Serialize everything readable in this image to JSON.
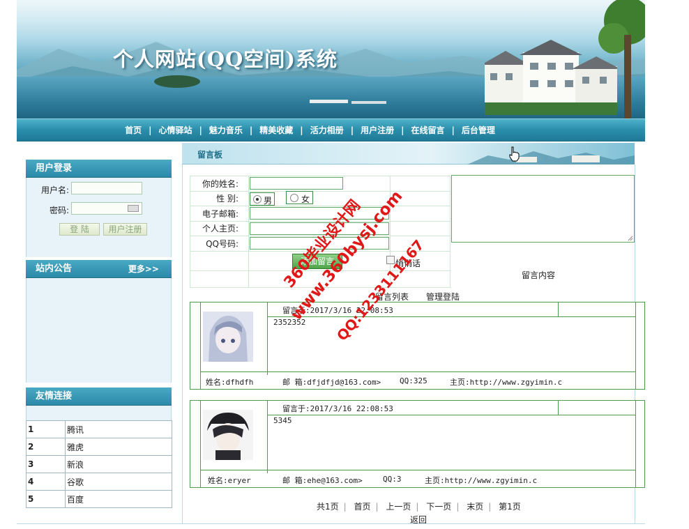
{
  "header": {
    "site_title": "个人网站(QQ空间)系统"
  },
  "nav": {
    "items": [
      {
        "label": "首页"
      },
      {
        "label": "心情驿站"
      },
      {
        "label": "魅力音乐"
      },
      {
        "label": "精美收藏"
      },
      {
        "label": "活力相册"
      },
      {
        "label": "用户注册"
      },
      {
        "label": "在线留言"
      },
      {
        "label": "后台管理"
      }
    ],
    "separator": "|"
  },
  "login": {
    "title": "用户登录",
    "username_label": "用户名:",
    "password_label": "密码:",
    "login_button": "登 陆",
    "register_button": "用户注册"
  },
  "notice": {
    "title": "站内公告",
    "more": "更多>>"
  },
  "links": {
    "title": "友情连接",
    "rows": [
      {
        "num": "1",
        "name": "腾讯"
      },
      {
        "num": "2",
        "name": "雅虎"
      },
      {
        "num": "3",
        "name": "新浪"
      },
      {
        "num": "4",
        "name": "谷歌"
      },
      {
        "num": "5",
        "name": "百度"
      }
    ]
  },
  "board": {
    "title": "留言板",
    "form": {
      "name_label": "你的姓名:",
      "gender_label": "性  别:",
      "male": "男",
      "female": "女",
      "email_label": "电子邮箱:",
      "homepage_label": "个人主页:",
      "qq_label": "QQ号码:",
      "submit": "添加留言",
      "whisper": "悄悄话",
      "content_label": "留言内容"
    },
    "list_title": "留言列表",
    "admin_link": "管理登陆",
    "messages": [
      {
        "time": "留言于:2017/3/16 22:08:53",
        "content": "2352352",
        "name": "姓名:dfhdfh",
        "email": "邮 箱:dfjdfjd@163.com>",
        "qq": "QQ:325",
        "homepage": "主页:http://www.zgyimin.c"
      },
      {
        "time": "留言于:2017/3/16 22:08:53",
        "content": "5345",
        "name": "姓名:eryer",
        "email": "邮 箱:ehe@163.com>",
        "qq": "QQ:3",
        "homepage": "主页:http://www.zgyimin.c"
      }
    ],
    "pager": {
      "total": "共1页",
      "first": "首页",
      "prev": "上一页",
      "next": "下一页",
      "last": "末页",
      "current": "第1页"
    },
    "back": "返回"
  },
  "watermark": {
    "line1": "360毕业设计网",
    "line2": "www.360bysj.com",
    "line3": "QQ:1233111167"
  },
  "colors": {
    "nav_bg": "#2a8eab",
    "accent_green": "#4e9a4e",
    "watermark_red": "#e01818"
  }
}
